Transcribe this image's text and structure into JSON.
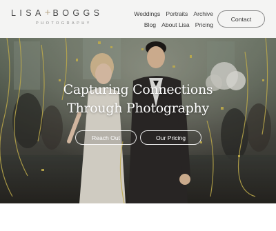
{
  "header": {
    "logo_main_left": "LISA",
    "logo_plus": "+",
    "logo_main_right": "BOGGS",
    "logo_sub": "PHOTOGRAPHY",
    "nav_row1": [
      "Weddings",
      "Portraits",
      "Archive"
    ],
    "nav_row2": [
      "Blog",
      "About Lisa",
      "Pricing"
    ],
    "contact_label": "Contact"
  },
  "hero": {
    "title_line1": "Capturing Connections",
    "title_line2": "Through Photography",
    "reach_out_label": "Reach Out",
    "our_pricing_label": "Our Pricing"
  },
  "colors": {
    "header_bg": "#f4f4f3",
    "accent_gold": "#b9a98c",
    "confetti": "#d8c255"
  }
}
